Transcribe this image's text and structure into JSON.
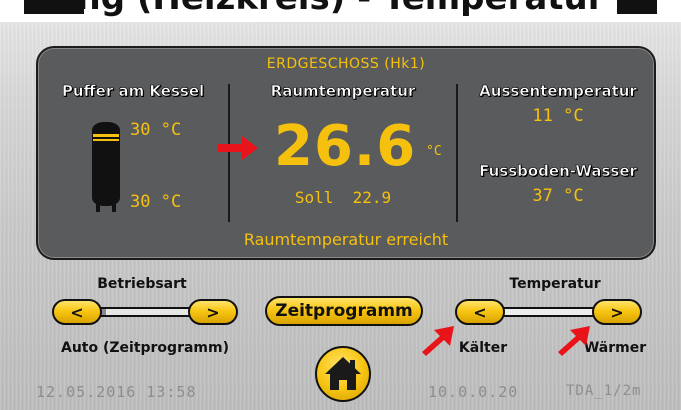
{
  "header": {
    "partial_title": "ng (Heizkreis) - Temperatur"
  },
  "panel": {
    "title": "ERDGESCHOSS (Hk1)",
    "buffer": {
      "label": "Puffer am Kessel",
      "top_temp": "30 °C",
      "bottom_temp": "30 °C"
    },
    "room": {
      "label": "Raumtemperatur",
      "value": "26.6",
      "unit": "°C",
      "setpoint": "Soll  22.9"
    },
    "outdoor": {
      "label": "Aussentemperatur",
      "value": "11 °C"
    },
    "floor_water": {
      "label": "Fussboden-Wasser",
      "value": "37 °C"
    },
    "status": "Raumtemperatur erreicht"
  },
  "controls": {
    "mode": {
      "label": "Betriebsart",
      "value": "Auto (Zeitprogramm)",
      "prev": "<",
      "next": ">",
      "slider_level": 0.12
    },
    "schedule_button": "Zeitprogramm",
    "temperature": {
      "label": "Temperatur",
      "prev": "<",
      "next": ">",
      "colder": "Kälter",
      "warmer": "Wärmer"
    }
  },
  "footer": {
    "datetime": "12.05.2016 13:58",
    "ip": "10.0.0.20",
    "device": "TDA_1/2m"
  },
  "colors": {
    "accent_yellow": "#f6c10e",
    "panel": "#5a5b5d",
    "arrow": "#e8141a"
  },
  "icons": [
    "tank-icon",
    "red-arrow-icon",
    "home-icon"
  ]
}
